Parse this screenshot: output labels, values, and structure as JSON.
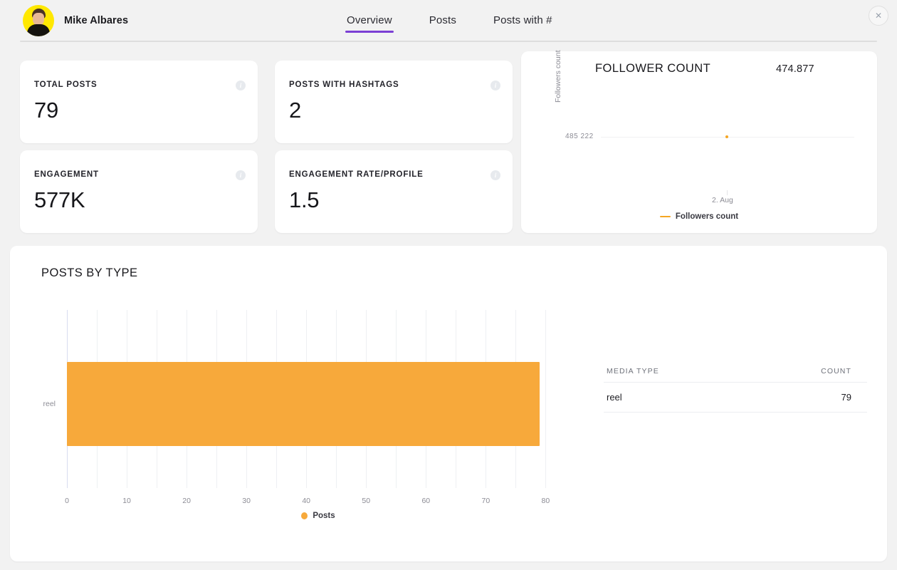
{
  "header": {
    "profile_name": "Mike Albares",
    "avatar_icon": "user-avatar",
    "close_icon": "close-icon",
    "tabs": [
      {
        "label": "Overview",
        "active": true
      },
      {
        "label": "Posts",
        "active": false
      },
      {
        "label": "Posts with #",
        "active": false
      }
    ]
  },
  "kpis": [
    {
      "label": "TOTAL POSTS",
      "value": "79",
      "info_icon": "info-icon"
    },
    {
      "label": "POSTS WITH HASHTAGS",
      "value": "2",
      "info_icon": "info-icon"
    },
    {
      "label": "ENGAGEMENT",
      "value": "577K",
      "info_icon": "info-icon"
    },
    {
      "label": "ENGAGEMENT RATE/PROFILE",
      "value": "1.5",
      "info_icon": "info-icon"
    }
  ],
  "follower_panel": {
    "title": "FOLLOWER COUNT",
    "total": "474.877",
    "legend_label": "Followers count"
  },
  "posts_by_type": {
    "title": "POSTS BY TYPE",
    "legend_label": "Posts",
    "table": {
      "headers": [
        "MEDIA TYPE",
        "COUNT"
      ],
      "rows": [
        {
          "media_type": "reel",
          "count": "79"
        }
      ]
    }
  },
  "colors": {
    "accent_orange": "#f7a93b",
    "line_orange": "#f5a623",
    "tab_underline_purple": "#7b3fd4",
    "avatar_yellow": "#ffe800",
    "page_background": "#f2f2f2",
    "card_background": "#ffffff"
  },
  "chart_data": [
    {
      "type": "line",
      "title": "FOLLOWER COUNT",
      "xlabel": "",
      "ylabel": "Followers count",
      "x": [
        "2. Aug"
      ],
      "xticklabels": [
        "2. Aug"
      ],
      "yticklabels": [
        "485 222"
      ],
      "series": [
        {
          "name": "Followers count",
          "values": [
            485222
          ],
          "color": "#f5a623"
        }
      ],
      "legend": [
        "Followers count"
      ],
      "legend_position": "bottom",
      "grid": true,
      "annotations": [
        "474.877"
      ]
    },
    {
      "type": "bar",
      "orientation": "horizontal",
      "title": "POSTS BY TYPE",
      "categories": [
        "reel"
      ],
      "values": [
        79
      ],
      "xlabel": "",
      "ylabel": "",
      "xlim": [
        0,
        84
      ],
      "xticks": [
        0,
        10,
        20,
        30,
        40,
        50,
        60,
        70,
        80
      ],
      "xticklabels": [
        "0",
        "10",
        "20",
        "30",
        "40",
        "50",
        "60",
        "70",
        "80"
      ],
      "series": [
        {
          "name": "Posts",
          "values": [
            79
          ],
          "color": "#f7a93b"
        }
      ],
      "legend": [
        "Posts"
      ],
      "legend_position": "bottom",
      "grid": true
    }
  ]
}
